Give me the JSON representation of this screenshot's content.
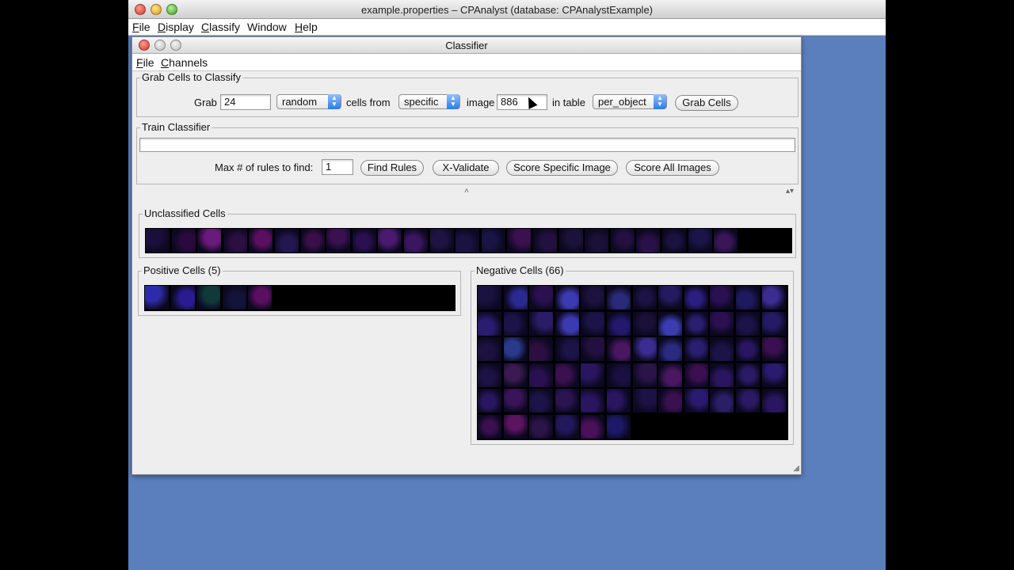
{
  "outer_window": {
    "title": "example.properties – CPAnalyst (database: CPAnalystExample)",
    "menu": [
      {
        "label": "File",
        "u": "F",
        "rest": "ile"
      },
      {
        "label": "Display",
        "u": "D",
        "rest": "isplay"
      },
      {
        "label": "Classify",
        "u": "C",
        "rest": "lassify"
      },
      {
        "label": "Window",
        "u": "",
        "rest": "Window"
      },
      {
        "label": "Help",
        "u": "H",
        "rest": "elp"
      }
    ]
  },
  "classifier": {
    "title": "Classifier",
    "menu": [
      {
        "label": "File",
        "u": "F",
        "rest": "ile"
      },
      {
        "label": "Channels",
        "u": "C",
        "rest": "hannels"
      }
    ],
    "grab": {
      "group_label": "Grab Cells to Classify",
      "grab_label": "Grab",
      "count": "24",
      "mode": "random",
      "cells_from_label": "cells from",
      "source": "specific",
      "image_label": "image",
      "image_number": "886",
      "in_table_label": "in table",
      "table": "per_object",
      "grab_button": "Grab Cells"
    },
    "train": {
      "group_label": "Train Classifier",
      "rules_text": "",
      "max_rules_label": "Max # of rules to find:",
      "max_rules": "1",
      "find_rules": "Find Rules",
      "x_validate": "X-Validate",
      "score_specific": "Score Specific Image",
      "score_all": "Score All Images"
    },
    "splitter_glyph": "˄",
    "unclassified": {
      "label": "Unclassified Cells",
      "colors": [
        "#1a0f3a",
        "#2a0a3c",
        "#6a1a7a",
        "#2a0f40",
        "#5a1060",
        "#221750",
        "#3a0f48",
        "#3a1050",
        "#2a1050",
        "#4a1a70",
        "#3a1560",
        "#1e1444",
        "#1a1240",
        "#1a1444",
        "#3a1050",
        "#241040",
        "#1a1238",
        "#1a1038",
        "#221040",
        "#2a1048",
        "#1c1240",
        "#1a1448",
        "#3a1658"
      ]
    },
    "positive": {
      "label": "Positive Cells (5)",
      "colors": [
        "#2c2ca8",
        "#2a1c90",
        "#103a3a",
        "#141438",
        "#5a0f60"
      ]
    },
    "negative": {
      "label": "Negative Cells (66)",
      "colors": [
        "#1a1240",
        "#2a2a90",
        "#2a1050",
        "#3c3ab0",
        "#1c1240",
        "#2a2a7a",
        "#1c1244",
        "#241a60",
        "#2a1e80",
        "#2a1050",
        "#1e1a60",
        "#3a2c90",
        "#2a1c70",
        "#1c1448",
        "#2a1c66",
        "#3c3ab0",
        "#1c1448",
        "#22186c",
        "#1a1038",
        "#3a3cb0",
        "#2a1e70",
        "#2a1050",
        "#1c1448",
        "#241a66",
        "#1c1240",
        "#2a3a8a",
        "#2a0f40",
        "#1c1448",
        "#241040",
        "#4a1660",
        "#3a2c90",
        "#2a2a80",
        "#2a1e70",
        "#1c1448",
        "#2a1660",
        "#3a1050",
        "#1c1244",
        "#3a1a50",
        "#2a1050",
        "#3a1050",
        "#2a1660",
        "#1a1040",
        "#2a1448",
        "#4a1860",
        "#3a1050",
        "#2a1660",
        "#2a1a66",
        "#2a1a70",
        "#2a1660",
        "#3a1458",
        "#1c1448",
        "#2a1550",
        "#2a1660",
        "#2a1660",
        "#1c1244",
        "#3a1050",
        "#2a1a70",
        "#2a1e66",
        "#2a1a66",
        "#2a1660",
        "#3a1050",
        "#5a1460",
        "#2a1448",
        "#22185c",
        "#4a1058",
        "#1c1a66"
      ]
    }
  }
}
